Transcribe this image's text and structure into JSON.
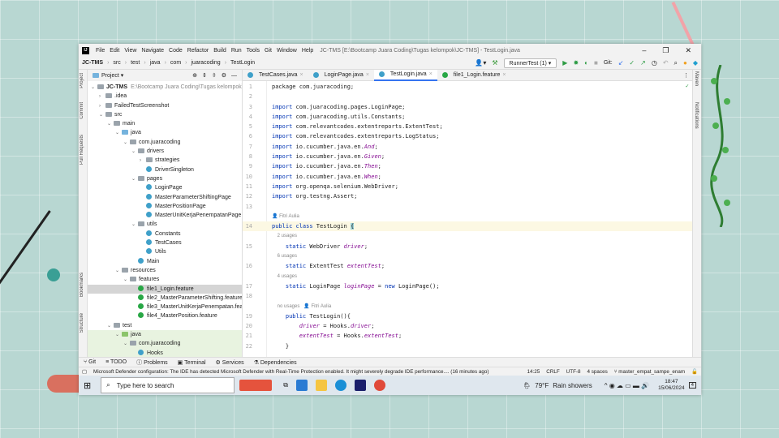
{
  "window": {
    "title": "JC-TMS [E:\\Bootcamp Juara Coding\\Tugas kelompok\\JC-TMS] - TestLogin.java"
  },
  "menu": [
    "File",
    "Edit",
    "View",
    "Navigate",
    "Code",
    "Refactor",
    "Build",
    "Run",
    "Tools",
    "Git",
    "Window",
    "Help"
  ],
  "breadcrumb": [
    "JC-TMS",
    "src",
    "test",
    "java",
    "com",
    "juaracoding",
    "TestLogin"
  ],
  "toolbar": {
    "run_config": "RunnerTest (1)",
    "git_label": "Git:"
  },
  "project": {
    "header": "Project",
    "root": "JC-TMS",
    "root_path": "E:\\Bootcamp Juara Coding\\Tugas kelompok\\JC-TMS",
    "tree": [
      {
        "l": 0,
        "a": "v",
        "i": "mod",
        "t": "JC-TMS"
      },
      {
        "l": 1,
        "a": ">",
        "i": "fold",
        "t": ".idea"
      },
      {
        "l": 1,
        "a": ">",
        "i": "fold",
        "t": "FailedTestScreenshot"
      },
      {
        "l": 1,
        "a": "v",
        "i": "fold",
        "t": "src"
      },
      {
        "l": 2,
        "a": "v",
        "i": "fold",
        "t": "main"
      },
      {
        "l": 3,
        "a": "v",
        "i": "blue",
        "t": "java"
      },
      {
        "l": 4,
        "a": "v",
        "i": "fold",
        "t": "com.juaracoding"
      },
      {
        "l": 5,
        "a": "v",
        "i": "fold",
        "t": "drivers"
      },
      {
        "l": 6,
        "a": ">",
        "i": "fold",
        "t": "strategies"
      },
      {
        "l": 6,
        "a": "",
        "i": "cls",
        "t": "DriverSingleton"
      },
      {
        "l": 5,
        "a": "v",
        "i": "fold",
        "t": "pages"
      },
      {
        "l": 6,
        "a": "",
        "i": "cls",
        "t": "LoginPage"
      },
      {
        "l": 6,
        "a": "",
        "i": "cls",
        "t": "MasterParameterShiftingPage"
      },
      {
        "l": 6,
        "a": "",
        "i": "cls",
        "t": "MasterPositionPage"
      },
      {
        "l": 6,
        "a": "",
        "i": "cls",
        "t": "MasterUnitKerjaPenempatanPage"
      },
      {
        "l": 5,
        "a": "v",
        "i": "fold",
        "t": "utils"
      },
      {
        "l": 6,
        "a": "",
        "i": "cls",
        "t": "Constants"
      },
      {
        "l": 6,
        "a": "",
        "i": "cls",
        "t": "TestCases"
      },
      {
        "l": 6,
        "a": "",
        "i": "cls",
        "t": "Utils"
      },
      {
        "l": 5,
        "a": "",
        "i": "cls",
        "t": "Main"
      },
      {
        "l": 3,
        "a": "v",
        "i": "fold",
        "t": "resources"
      },
      {
        "l": 4,
        "a": "v",
        "i": "fold",
        "t": "features"
      },
      {
        "l": 5,
        "a": "",
        "i": "feat",
        "t": "file1_Login.feature",
        "sel": true
      },
      {
        "l": 5,
        "a": "",
        "i": "feat",
        "t": "file2_MasterParameterShifting.feature"
      },
      {
        "l": 5,
        "a": "",
        "i": "feat",
        "t": "file3_MasterUnitKerjaPenempatan.feature"
      },
      {
        "l": 5,
        "a": "",
        "i": "feat",
        "t": "file4_MasterPosition.feature"
      },
      {
        "l": 2,
        "a": "v",
        "i": "fold",
        "t": "test"
      },
      {
        "l": 3,
        "a": "v",
        "i": "green",
        "t": "java",
        "test": true
      },
      {
        "l": 4,
        "a": "v",
        "i": "fold",
        "t": "com.juaracoding",
        "test": true
      },
      {
        "l": 5,
        "a": "",
        "i": "cls",
        "t": "Hooks",
        "test": true
      }
    ]
  },
  "left_strip": [
    "Project",
    "Commit",
    "Pull Requests",
    "Bookmarks",
    "Structure"
  ],
  "right_strip": [
    "Maven",
    "Notifications"
  ],
  "tabs": [
    {
      "label": "TestCases.java"
    },
    {
      "label": "LoginPage.java"
    },
    {
      "label": "TestLogin.java",
      "active": true
    },
    {
      "label": "file1_Login.feature"
    }
  ],
  "code": [
    {
      "n": "1",
      "k": [
        [
          "package ",
          ""
        ],
        [
          "com.juaracoding;",
          ""
        ]
      ]
    },
    {
      "n": "2",
      "k": []
    },
    {
      "n": "3",
      "k": [
        [
          "import ",
          "kw"
        ],
        [
          "com.juaracoding.pages.LoginPage;",
          ""
        ]
      ]
    },
    {
      "n": "4",
      "k": [
        [
          "import ",
          "kw"
        ],
        [
          "com.juaracoding.utils.Constants;",
          ""
        ]
      ]
    },
    {
      "n": "5",
      "k": [
        [
          "import ",
          "kw"
        ],
        [
          "com.relevantcodes.extentreports.ExtentTest;",
          ""
        ]
      ]
    },
    {
      "n": "6",
      "k": [
        [
          "import ",
          "kw"
        ],
        [
          "com.relevantcodes.extentreports.LogStatus;",
          ""
        ]
      ]
    },
    {
      "n": "7",
      "k": [
        [
          "import ",
          "kw"
        ],
        [
          "io.cucumber.java.en.",
          ""
        ],
        [
          "And",
          "it"
        ],
        [
          ";",
          ""
        ]
      ]
    },
    {
      "n": "8",
      "k": [
        [
          "import ",
          "kw"
        ],
        [
          "io.cucumber.java.en.",
          ""
        ],
        [
          "Given",
          "it"
        ],
        [
          ";",
          ""
        ]
      ]
    },
    {
      "n": "9",
      "k": [
        [
          "import ",
          "kw"
        ],
        [
          "io.cucumber.java.en.",
          ""
        ],
        [
          "Then",
          "it"
        ],
        [
          ";",
          ""
        ]
      ]
    },
    {
      "n": "10",
      "k": [
        [
          "import ",
          "kw"
        ],
        [
          "io.cucumber.java.en.",
          ""
        ],
        [
          "When",
          "it"
        ],
        [
          ";",
          ""
        ]
      ]
    },
    {
      "n": "11",
      "k": [
        [
          "import ",
          "kw"
        ],
        [
          "org.openqa.selenium.WebDriver;",
          ""
        ]
      ]
    },
    {
      "n": "12",
      "k": [
        [
          "import ",
          "kw"
        ],
        [
          "org.testng.Assert;",
          ""
        ]
      ]
    },
    {
      "n": "13",
      "k": []
    },
    {
      "hint": "👤 Fitri Aulia"
    },
    {
      "n": "14",
      "cur": true,
      "k": [
        [
          "public class ",
          "kw"
        ],
        [
          "TestLogin ",
          ""
        ],
        [
          "{",
          "br"
        ]
      ]
    },
    {
      "hint": "    2 usages"
    },
    {
      "n": "15",
      "k": [
        [
          "    static ",
          "kw"
        ],
        [
          "WebDriver ",
          ""
        ],
        [
          "driver",
          "it"
        ],
        [
          ";",
          ""
        ]
      ]
    },
    {
      "hint": "    6 usages"
    },
    {
      "n": "16",
      "k": [
        [
          "    static ",
          "kw"
        ],
        [
          "ExtentTest ",
          ""
        ],
        [
          "extentTest",
          "it"
        ],
        [
          ";",
          ""
        ]
      ]
    },
    {
      "hint": "    4 usages"
    },
    {
      "n": "17",
      "k": [
        [
          "    static ",
          "kw"
        ],
        [
          "LoginPage ",
          ""
        ],
        [
          "loginPage",
          "it"
        ],
        [
          " = ",
          ""
        ],
        [
          "new ",
          "kw"
        ],
        [
          "LoginPage();",
          ""
        ]
      ]
    },
    {
      "n": "18",
      "k": []
    },
    {
      "hint": "    no usages   👤 Fitri Aulia"
    },
    {
      "n": "19",
      "k": [
        [
          "    public ",
          "kw"
        ],
        [
          "TestLogin(){",
          ""
        ]
      ]
    },
    {
      "n": "20",
      "k": [
        [
          "        ",
          ""
        ],
        [
          "driver",
          "it"
        ],
        [
          " = Hooks.",
          ""
        ],
        [
          "driver",
          "it"
        ],
        [
          ";",
          ""
        ]
      ]
    },
    {
      "n": "21",
      "k": [
        [
          "        ",
          ""
        ],
        [
          "extentTest",
          "it"
        ],
        [
          " = Hooks.",
          ""
        ],
        [
          "extentTest",
          "it"
        ],
        [
          ";",
          ""
        ]
      ]
    },
    {
      "n": "22",
      "k": [
        [
          "    }",
          ""
        ]
      ]
    }
  ],
  "bottom_tabs": [
    "Git",
    "TODO",
    "Problems",
    "Terminal",
    "Services",
    "Dependencies"
  ],
  "status": {
    "message": "Microsoft Defender configuration: The IDE has detected Microsoft Defender with Real-Time Protection enabled. It might severely degrade IDE performance.... (16 minutes ago)",
    "position": "14:25",
    "line_sep": "CRLF",
    "encoding": "UTF-8",
    "indent": "4 spaces",
    "branch": "master_empat_sampe_enam"
  },
  "taskbar": {
    "search_placeholder": "Type here to search",
    "weather": "79°F",
    "weather_desc": "Rain showers",
    "time": "18:47",
    "date": "15/06/2024",
    "notif_count": "4"
  }
}
